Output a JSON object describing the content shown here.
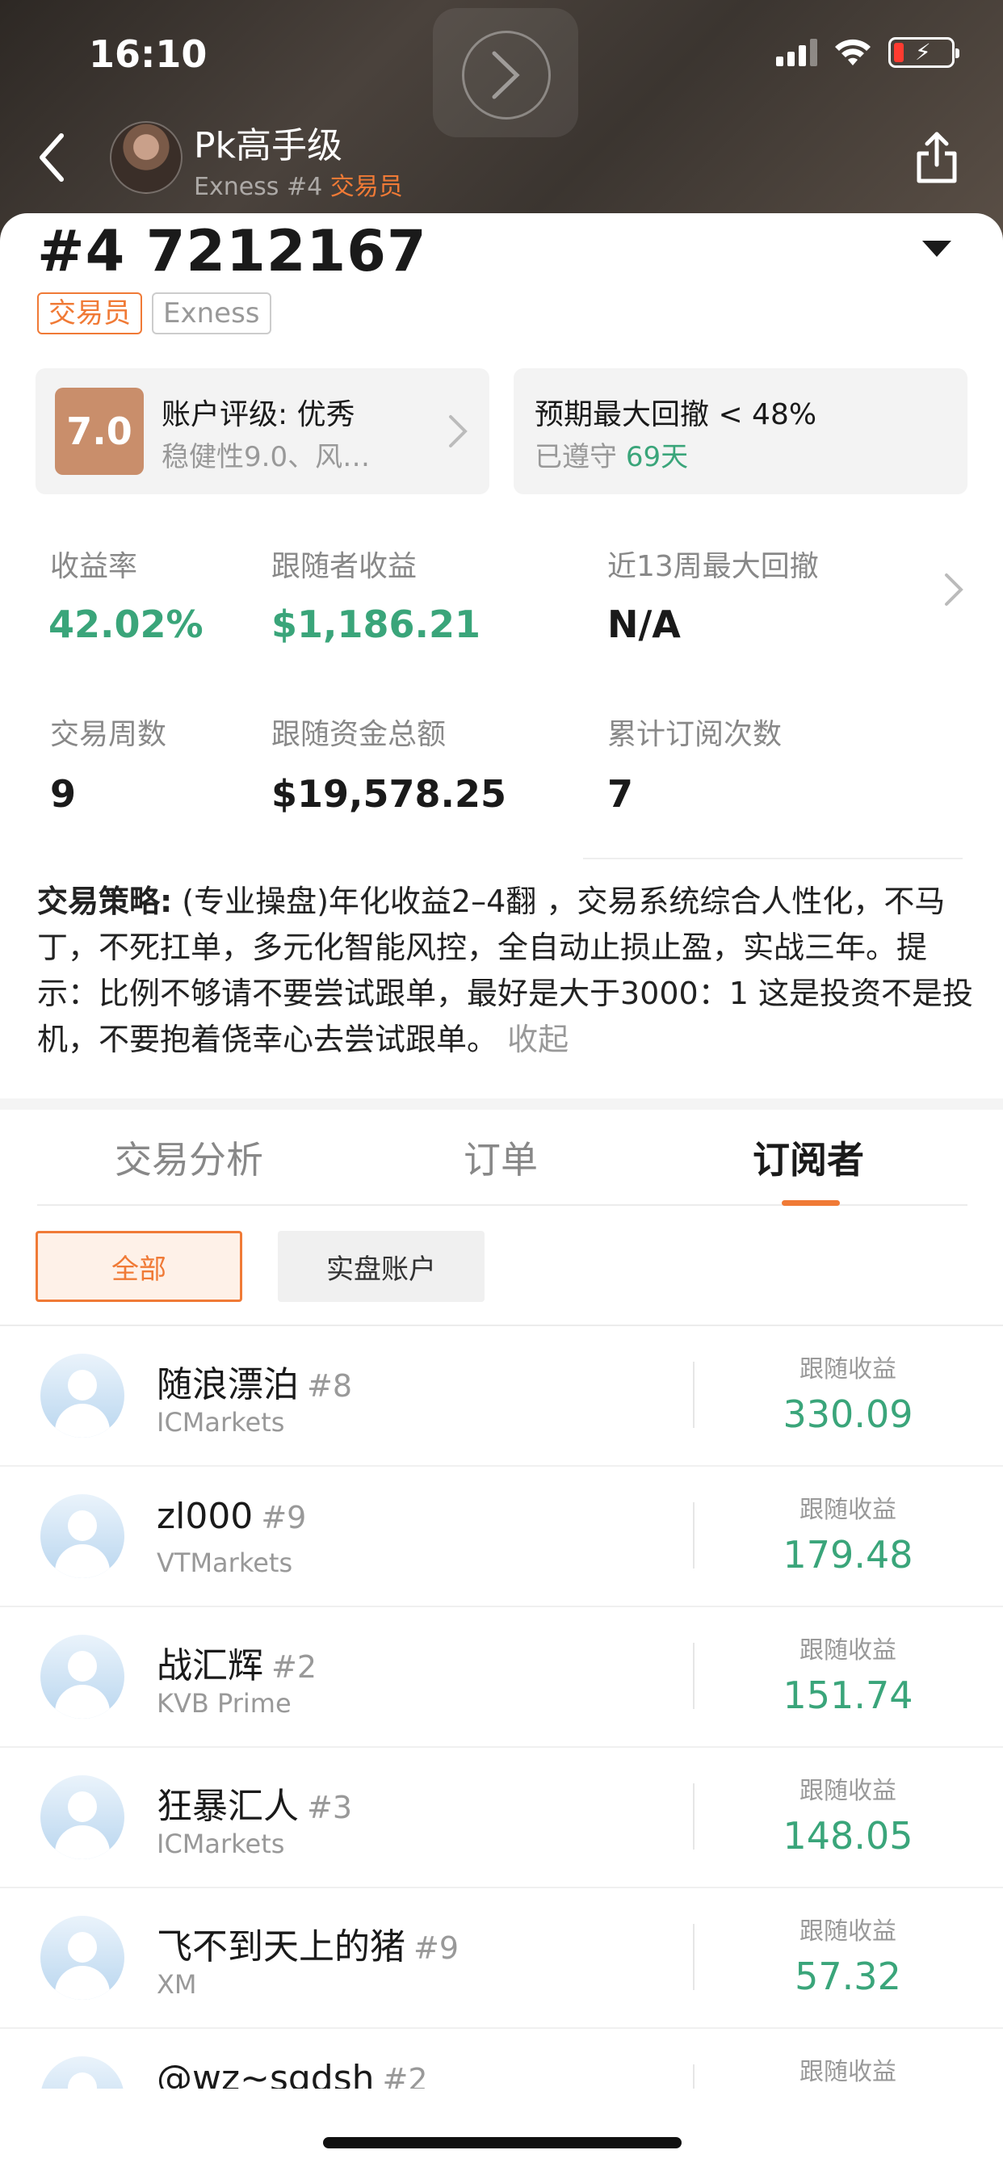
{
  "status_bar": {
    "time": "16:10"
  },
  "header": {
    "name": "Pk高手级",
    "broker_no": "Exness #4",
    "role": "交易员"
  },
  "account": {
    "number": "#4 7212167",
    "tags": [
      "交易员",
      "Exness"
    ]
  },
  "rating_box": {
    "score": "7.0",
    "title": "账户评级: 优秀",
    "subtitle": "稳健性9.0、风…"
  },
  "drawdown_box": {
    "title": "预期最大回撤 < 48%",
    "compliance_prefix": "已遵守 ",
    "compliance_days": "69天"
  },
  "stats": {
    "return_rate_label": "收益率",
    "return_rate_value": "42.02%",
    "follower_profit_label": "跟随者收益",
    "follower_profit_value": "$1,186.21",
    "drawdown13_label": "近13周最大回撤",
    "drawdown13_value": "N/A",
    "weeks_label": "交易周数",
    "weeks_value": "9",
    "follow_funds_label": "跟随资金总额",
    "follow_funds_value": "$19,578.25",
    "subs_label": "累计订阅次数",
    "subs_value": "7"
  },
  "strategy": {
    "label": "交易策略:",
    "text": " (专业操盘)年化收益2–4翻 ，交易系统综合人性化，不马丁，不死扛单，多元化智能风控，全自动止损止盈，实战三年。提示：比例不够请不要尝试跟单，最好是大于3000：1 这是投资不是投机，不要抱着侥幸心去尝试跟单。",
    "collapse": "收起"
  },
  "tabs": [
    "交易分析",
    "订单",
    "订阅者"
  ],
  "filters": [
    "全部",
    "实盘账户"
  ],
  "subscribers": {
    "profit_label": "跟随收益",
    "rows": [
      {
        "name": "随浪漂泊",
        "rank": "#8",
        "broker": "ICMarkets",
        "profit": "330.09"
      },
      {
        "name": "zl000",
        "rank": "#9",
        "broker": "VTMarkets",
        "profit": "179.48"
      },
      {
        "name": "战汇辉",
        "rank": "#2",
        "broker": "KVB Prime",
        "profit": "151.74"
      },
      {
        "name": "狂暴汇人",
        "rank": "#3",
        "broker": "ICMarkets",
        "profit": "148.05"
      },
      {
        "name": "飞不到天上的猪",
        "rank": "#9",
        "broker": "XM",
        "profit": "57.32"
      },
      {
        "name": "@wz~sgdsh",
        "rank": "#2",
        "broker": "",
        "profit": ""
      }
    ]
  },
  "colors": {
    "accent": "#f07a36",
    "positive": "#3aa57a",
    "score_bg": "#c98e6b"
  }
}
